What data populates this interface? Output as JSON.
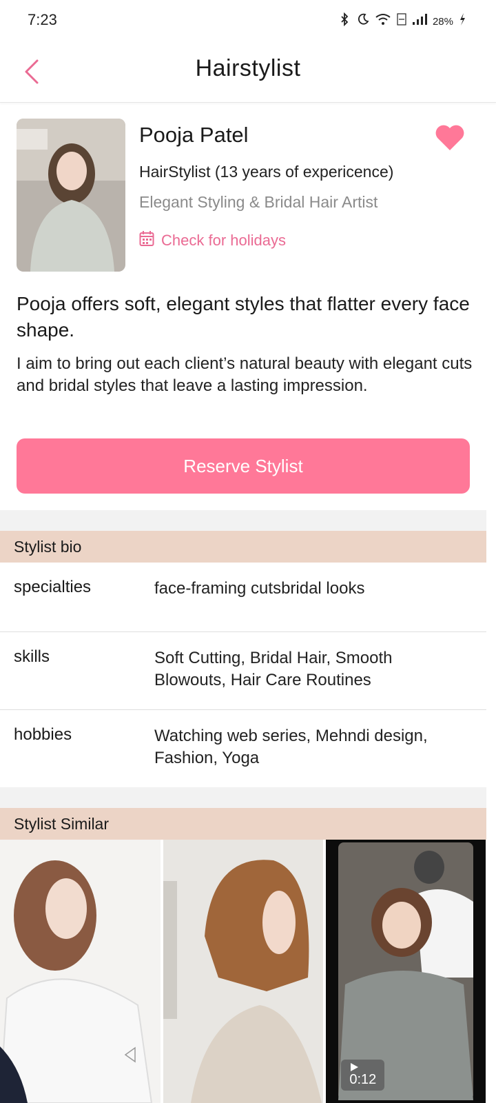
{
  "status_bar": {
    "time": "7:23",
    "battery": "28%"
  },
  "header": {
    "title": "Hairstylist",
    "back_icon": "chevron-left-icon"
  },
  "profile": {
    "name": "Pooja Patel",
    "role": "HairStylist (13 years of expericence)",
    "tagline": "Elegant Styling & Bridal Hair Artist",
    "holidays_link": "Check for holidays",
    "favorite": true
  },
  "headline": "Pooja offers soft, elegant styles that flatter every face shape.",
  "bio_text": "I aim to bring out each client’s natural beauty with elegant cuts and bridal styles that leave a lasting impression.",
  "reserve_button": "Reserve Stylist",
  "bio_section": {
    "title": "Stylist bio",
    "rows": [
      {
        "key": "specialties",
        "value": "face-framing cutsbridal looks"
      },
      {
        "key": "skills",
        "value": "Soft Cutting, Bridal Hair, Smooth Blowouts, Hair Care Routines"
      },
      {
        "key": "hobbies",
        "value": "Watching web series, Mehndi design, Fashion, Yoga"
      }
    ]
  },
  "similar_section": {
    "title": "Stylist Similar",
    "video_duration": "0:12"
  },
  "colors": {
    "accent": "#ff7898",
    "pink_text": "#ea6a93",
    "section_bg": "#ecd4c6"
  }
}
